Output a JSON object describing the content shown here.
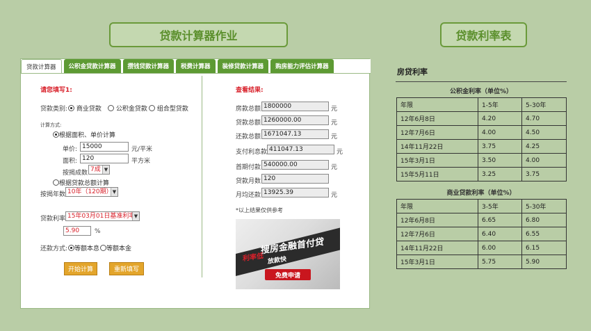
{
  "headers": {
    "calc_title": "贷款计算器作业",
    "rate_title": "贷款利率表"
  },
  "tabs": [
    "贷款计算器",
    "公积金贷款计算器",
    "攒钱贷款计算器",
    "税费计算器",
    "装修贷款计算器",
    "购房能力评估计算器"
  ],
  "form": {
    "section_title": "请您填写1:",
    "loan_type_label": "贷款类别:",
    "loan_types": [
      "商业贷款",
      "公积金贷款",
      "组合型贷款"
    ],
    "calc_method_label": "计算方式:",
    "method_area": "根据面积、单价计算",
    "unit_price_label": "单价:",
    "unit_price": "15000",
    "unit_price_unit": "元/平米",
    "area_label": "面积:",
    "area": "120",
    "area_unit": "平方米",
    "ratio_label": "按揭成数",
    "ratio": "7成",
    "method_total": "根据贷款总额计算",
    "years_label": "按揭年数",
    "years": "10年（120期）",
    "rate_label": "贷款利率",
    "rate_select": "15年03月01日基准利率",
    "rate_value": "5.90",
    "rate_unit": "%",
    "repay_label": "还款方式:",
    "repay_options": [
      "等额本息",
      "等额本金"
    ],
    "calc_button": "开始计算",
    "reset_button": "重新填写"
  },
  "results": {
    "title": "查看结果:",
    "rows": [
      {
        "label": "房款总额:",
        "value": "1800000",
        "unit": "元"
      },
      {
        "label": "贷款总额:",
        "value": "1260000.00",
        "unit": "元"
      },
      {
        "label": "还款总额:",
        "value": "1671047.13",
        "unit": "元"
      },
      {
        "label": "支付利息款:",
        "value": "411047.13",
        "unit": "元"
      },
      {
        "label": "首期付款:",
        "value": "540000.00",
        "unit": "元"
      },
      {
        "label": "贷款月数:",
        "value": "120",
        "unit": ""
      },
      {
        "label": "月均还款:",
        "value": "13925.39",
        "unit": "元"
      }
    ],
    "note": "*以上结果仅供参考",
    "ad": {
      "line1": "搜房金融首付贷",
      "line2": "利率低",
      "line3": "放款快",
      "cta": "免费申请"
    }
  },
  "rates": {
    "title": "房贷利率",
    "gjj_caption": "公积金利率（单位%）",
    "gjj_header": [
      "年限",
      "1-5年",
      "5-30年"
    ],
    "gjj_rows": [
      [
        "12年6月8日",
        "4.20",
        "4.70"
      ],
      [
        "12年7月6日",
        "4.00",
        "4.50"
      ],
      [
        "14年11月22日",
        "3.75",
        "4.25"
      ],
      [
        "15年3月1日",
        "3.50",
        "4.00"
      ],
      [
        "15年5月11日",
        "3.25",
        "3.75"
      ]
    ],
    "biz_caption": "商业贷款利率（单位%）",
    "biz_header": [
      "年限",
      "3-5年",
      "5-30年"
    ],
    "biz_rows": [
      [
        "12年6月8日",
        "6.65",
        "6.80"
      ],
      [
        "12年7月6日",
        "6.40",
        "6.55"
      ],
      [
        "14年11月22日",
        "6.00",
        "6.15"
      ],
      [
        "15年3月1日",
        "5.75",
        "5.90"
      ]
    ]
  },
  "colors": {
    "background": "#b9cda6",
    "tab_green": "#5d9a33",
    "accent_red": "#d8202a",
    "button_orange": "#e3a52b"
  }
}
